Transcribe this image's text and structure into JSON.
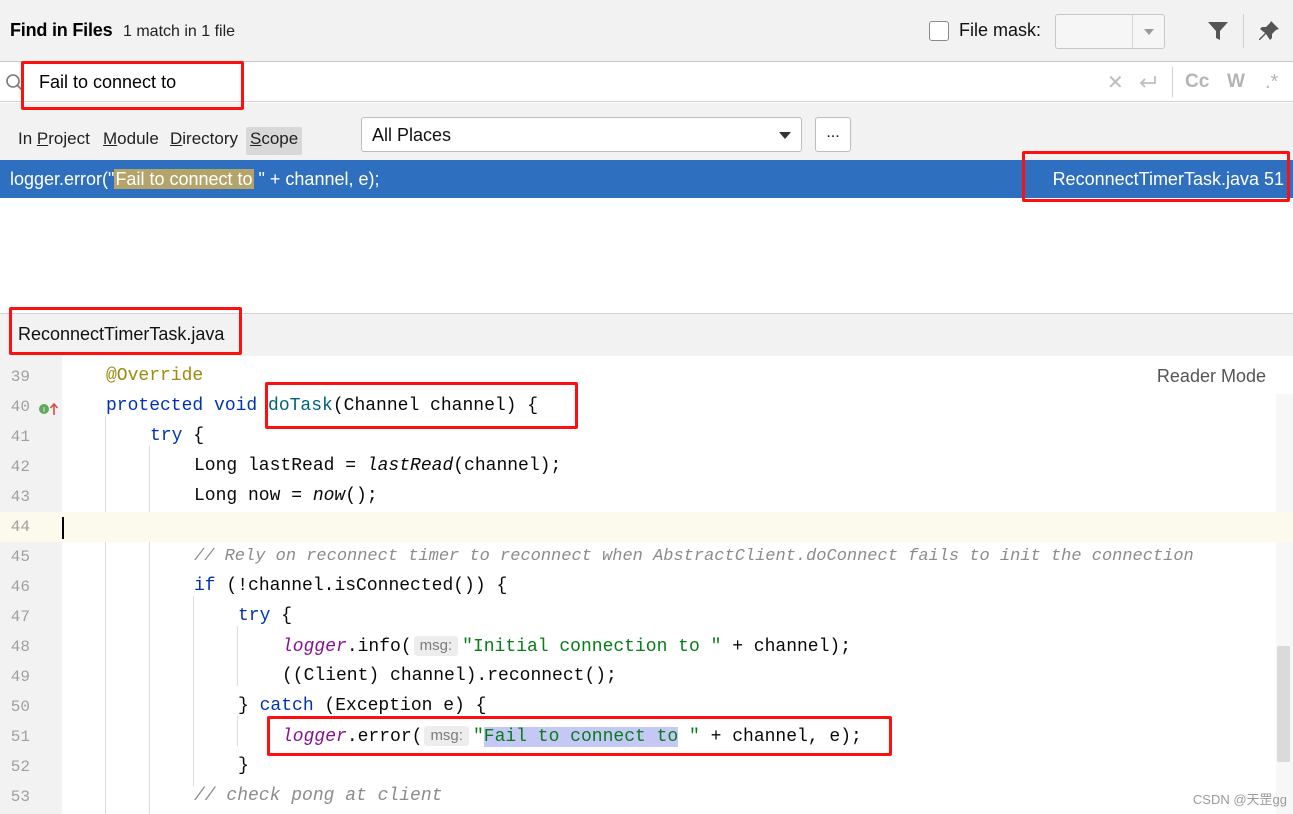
{
  "header": {
    "title": "Find in Files",
    "match_count": "1 match in 1 file",
    "file_mask_label": "File mask:",
    "file_mask_value": ""
  },
  "search": {
    "query": "Fail to connect to",
    "match_case_label": "Cc",
    "whole_words_label": "W",
    "regex_label": ".*"
  },
  "scope": {
    "tabs": [
      "In Project",
      "Module",
      "Directory",
      "Scope"
    ],
    "selected_tab": "Scope",
    "places_value": "All Places",
    "browse_label": "..."
  },
  "results": [
    {
      "code_before": "logger.error(\"",
      "code_match": "Fail to connect to",
      "code_after": " \" + channel, e);",
      "file": "ReconnectTimerTask.java 51"
    }
  ],
  "preview": {
    "file_name": "ReconnectTimerTask.java",
    "reader_mode_label": "Reader Mode",
    "current_line": 44,
    "lines": [
      {
        "n": "39"
      },
      {
        "n": "40"
      },
      {
        "n": "41"
      },
      {
        "n": "42"
      },
      {
        "n": "43"
      },
      {
        "n": "44"
      },
      {
        "n": "45"
      },
      {
        "n": "46"
      },
      {
        "n": "47"
      },
      {
        "n": "48"
      },
      {
        "n": "49"
      },
      {
        "n": "50"
      },
      {
        "n": "51"
      },
      {
        "n": "52"
      },
      {
        "n": "53"
      }
    ],
    "hint_label": "msg:",
    "code": {
      "l39_ann": "@Override",
      "l40_kw": "protected void ",
      "l40_fn": "doTask",
      "l40_rest": "(Channel channel) {",
      "l41_kw": "try",
      "l41_rest": " {",
      "l42_a": "Long lastRead = ",
      "l42_it": "lastRead",
      "l42_b": "(channel);",
      "l43_a": "Long now = ",
      "l43_it": "now",
      "l43_b": "();",
      "l45_cmt": "// Rely on reconnect timer to reconnect when AbstractClient.doConnect fails to init the connection",
      "l46_kw": "if",
      "l46_rest": " (!channel.isConnected()) {",
      "l47_kw": "try",
      "l47_rest": " {",
      "l48_fld": "logger",
      "l48_a": ".info(",
      "l48_str": "\"Initial connection to \"",
      "l48_b": " + channel);",
      "l49": "((Client) channel).reconnect();",
      "l50_a": "} ",
      "l50_kw": "catch",
      "l50_b": " (Exception e) {",
      "l51_fld": "logger",
      "l51_a": ".error(",
      "l51_str1": "\"",
      "l51_sel": "Fail to connect to",
      "l51_str2": " \"",
      "l51_b": " + channel, e);",
      "l52": "}",
      "l53_cmt": "// check pong at client"
    }
  },
  "watermark": "CSDN @天罡gg",
  "colors": {
    "selection_row": "#2f6fbf",
    "annotation_box": "#ff1010",
    "keyword": "#0033b3",
    "string": "#067d17"
  }
}
